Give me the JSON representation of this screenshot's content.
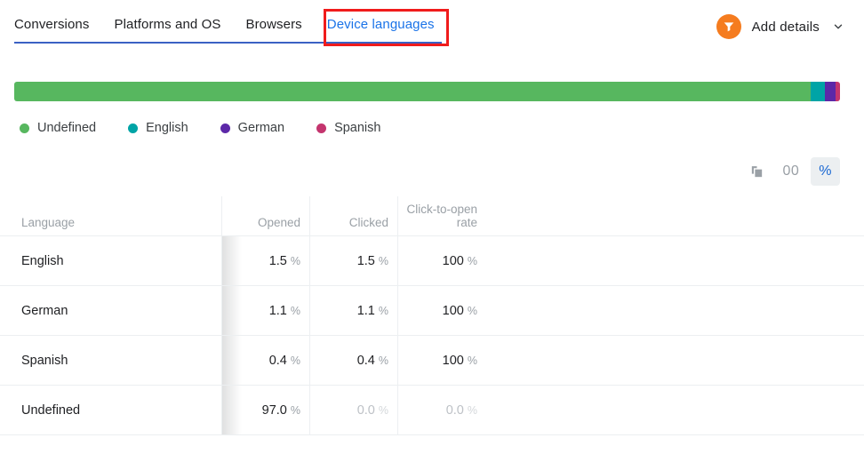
{
  "tabs": [
    {
      "label": "Conversions",
      "active": false
    },
    {
      "label": "Platforms and OS",
      "active": false
    },
    {
      "label": "Browsers",
      "active": false
    },
    {
      "label": "Device languages",
      "active": true
    }
  ],
  "header": {
    "add_details_label": "Add details",
    "funnel_icon": "funnel-icon",
    "chevron_icon": "chevron-down-icon",
    "accent_blue": "#1a73e8",
    "underline_blue": "#3b61c4",
    "annotation_color": "#f01c1c",
    "funnel_bg": "#f57c1f"
  },
  "toolbar": {
    "copy_icon": "copy-icon",
    "absolute_label": "00",
    "percent_label": "%",
    "selected_unit": "%"
  },
  "legend": [
    {
      "label": "Undefined",
      "color": "#57b75f"
    },
    {
      "label": "English",
      "color": "#00a4a6"
    },
    {
      "label": "German",
      "color": "#5c28a8"
    },
    {
      "label": "Spanish",
      "color": "#c4356e"
    }
  ],
  "chart_data": {
    "type": "bar",
    "orientation": "horizontal-stacked",
    "title": "",
    "xlabel": "",
    "ylabel": "",
    "categories": [
      "Undefined",
      "English",
      "German",
      "Spanish"
    ],
    "values": [
      96.5,
      1.7,
      1.3,
      0.5
    ],
    "unit": "%",
    "colors": [
      "#57b75f",
      "#00a4a6",
      "#5c28a8",
      "#c4356e"
    ],
    "legend_position": "bottom-left",
    "grid": false,
    "xlim": [
      0,
      100
    ]
  },
  "table": {
    "columns": [
      {
        "label": "Language",
        "align": "left"
      },
      {
        "label": "Opened",
        "align": "right"
      },
      {
        "label": "Clicked",
        "align": "right"
      },
      {
        "label": "Click-to-open rate",
        "align": "right"
      }
    ],
    "rows": [
      {
        "language": "English",
        "opened": "1.5",
        "opened_unit": "%",
        "opened_muted": false,
        "clicked": "1.5",
        "clicked_unit": "%",
        "clicked_muted": false,
        "ctor": "100",
        "ctor_unit": "%",
        "ctor_muted": false
      },
      {
        "language": "German",
        "opened": "1.1",
        "opened_unit": "%",
        "opened_muted": false,
        "clicked": "1.1",
        "clicked_unit": "%",
        "clicked_muted": false,
        "ctor": "100",
        "ctor_unit": "%",
        "ctor_muted": false
      },
      {
        "language": "Spanish",
        "opened": "0.4",
        "opened_unit": "%",
        "opened_muted": false,
        "clicked": "0.4",
        "clicked_unit": "%",
        "clicked_muted": false,
        "ctor": "100",
        "ctor_unit": "%",
        "ctor_muted": false
      },
      {
        "language": "Undefined",
        "opened": "97.0",
        "opened_unit": "%",
        "opened_muted": false,
        "clicked": "0.0",
        "clicked_unit": "%",
        "clicked_muted": true,
        "ctor": "0.0",
        "ctor_unit": "%",
        "ctor_muted": true
      }
    ]
  }
}
